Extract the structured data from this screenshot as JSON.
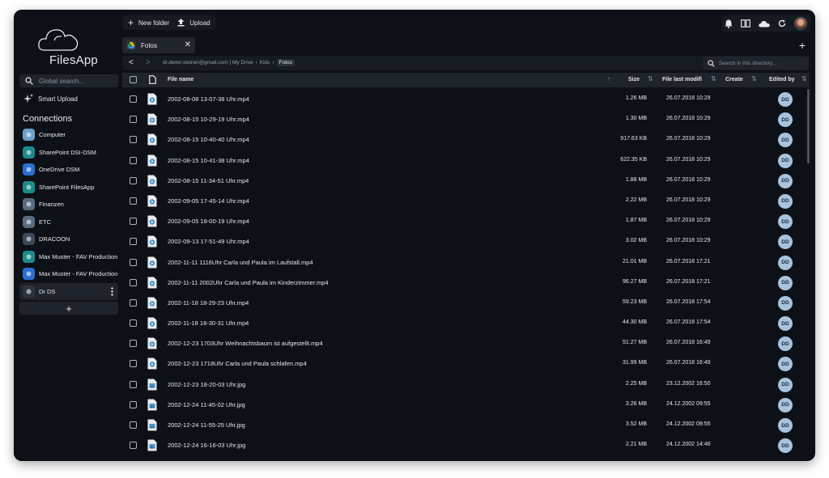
{
  "app": {
    "name": "FilesApp"
  },
  "sidebar": {
    "search_placeholder": "Global search...",
    "smart_upload": "Smart Upload",
    "connections_title": "Connections",
    "connections": [
      {
        "label": "Computer",
        "icon": "computer-icon",
        "color": "#6d9fc8"
      },
      {
        "label": "SharePoint DSI-DSM",
        "icon": "sharepoint-icon",
        "color": "#1d8a8a"
      },
      {
        "label": "OneDrive DSM",
        "icon": "onedrive-icon",
        "color": "#2a6fd1"
      },
      {
        "label": "SharePoint FilesApp",
        "icon": "sharepoint-icon",
        "color": "#1d8a8a"
      },
      {
        "label": "Finanzen",
        "icon": "folder-icon",
        "color": "#5a6b7d"
      },
      {
        "label": "ETC",
        "icon": "folder-icon",
        "color": "#5a6b7d"
      },
      {
        "label": "DRACOON",
        "icon": "dracoon-icon",
        "color": "#3b4a5a"
      },
      {
        "label": "Max Muster - FAV Production",
        "icon": "sharepoint-icon",
        "color": "#1d8a8a"
      },
      {
        "label": "Max Muster - FAV Production",
        "icon": "onedrive-icon",
        "color": "#2a6fd1"
      },
      {
        "label": "Dr DS",
        "icon": "google-drive-icon",
        "color": "#2b3440"
      }
    ]
  },
  "toolbar": {
    "new_folder": "New folder",
    "upload": "Upload"
  },
  "tab": {
    "label": "Fotos"
  },
  "path": {
    "segments": [
      "dr.dieter.steiner@gmail.com | My Drive",
      "Kids"
    ],
    "current": "Fotos",
    "search_placeholder": "Search in this directory..."
  },
  "columns": {
    "name": "File name",
    "size": "Size",
    "modified": "File last modifi",
    "created": "Create",
    "edited_by": "Edited by"
  },
  "files": [
    {
      "name": "2002-08-08 13-07-38 Uhr.mp4",
      "size": "1.26 MB",
      "modified": "26.07.2018 10:29",
      "by": "DD",
      "type": "video"
    },
    {
      "name": "2002-08-15 10-29-19 Uhr.mp4",
      "size": "1.30 MB",
      "modified": "26.07.2018 10:29",
      "by": "DD",
      "type": "video"
    },
    {
      "name": "2002-08-15 10-40-40 Uhr.mp4",
      "size": "917.63 KB",
      "modified": "26.07.2018 10:29",
      "by": "DD",
      "type": "video"
    },
    {
      "name": "2002-08-15 10-41-38 Uhr.mp4",
      "size": "622.35 KB",
      "modified": "26.07.2018 10:29",
      "by": "DD",
      "type": "video"
    },
    {
      "name": "2002-08-15 11-34-51 Uhr.mp4",
      "size": "1.88 MB",
      "modified": "26.07.2018 10:29",
      "by": "DD",
      "type": "video"
    },
    {
      "name": "2002-09-05 17-45-14 Uhr.mp4",
      "size": "2.22 MB",
      "modified": "26.07.2018 10:29",
      "by": "DD",
      "type": "video"
    },
    {
      "name": "2002-09-05 18-00-19 Uhr.mp4",
      "size": "1.87 MB",
      "modified": "26.07.2018 10:29",
      "by": "DD",
      "type": "video"
    },
    {
      "name": "2002-09-13 17-51-49 Uhr.mp4",
      "size": "3.02 MB",
      "modified": "26.07.2018 10:29",
      "by": "DD",
      "type": "video"
    },
    {
      "name": "2002-11-11 1116Uhr Carla und Paula im Laufstall.mp4",
      "size": "21.01 MB",
      "modified": "26.07.2018 17:21",
      "by": "DD",
      "type": "video"
    },
    {
      "name": "2002-11-11 2002Uhr Carla und Paula im Kinderzimmer.mp4",
      "size": "96.27 MB",
      "modified": "26.07.2018 17:21",
      "by": "DD",
      "type": "video"
    },
    {
      "name": "2002-11-18 18-29-23 Uhr.mp4",
      "size": "59.23 MB",
      "modified": "26.07.2018 17:54",
      "by": "DD",
      "type": "video"
    },
    {
      "name": "2002-11-18 18-30-31 Uhr.mp4",
      "size": "44.30 MB",
      "modified": "26.07.2018 17:54",
      "by": "DD",
      "type": "video"
    },
    {
      "name": "2002-12-23 1703Uhr Weihnachtsbaum ist aufgestellt.mp4",
      "size": "51.27 MB",
      "modified": "26.07.2018 16:49",
      "by": "DD",
      "type": "video"
    },
    {
      "name": "2002-12-23 1718Uhr Carla und Paula schlafen.mp4",
      "size": "31.99 MB",
      "modified": "26.07.2018 16:49",
      "by": "DD",
      "type": "video"
    },
    {
      "name": "2002-12-23 18-20-03 Uhr.jpg",
      "size": "2.25 MB",
      "modified": "23.12.2002 16:50",
      "by": "DD",
      "type": "image"
    },
    {
      "name": "2002-12-24 11-45-02 Uhr.jpg",
      "size": "3.26 MB",
      "modified": "24.12.2002 09:55",
      "by": "DD",
      "type": "image"
    },
    {
      "name": "2002-12-24 11-55-25 Uhr.jpg",
      "size": "3.52 MB",
      "modified": "24.12.2002 09:55",
      "by": "DD",
      "type": "image"
    },
    {
      "name": "2002-12-24 16-16-03 Uhr.jpg",
      "size": "2.21 MB",
      "modified": "24.12.2002 14:46",
      "by": "DD",
      "type": "image"
    }
  ]
}
